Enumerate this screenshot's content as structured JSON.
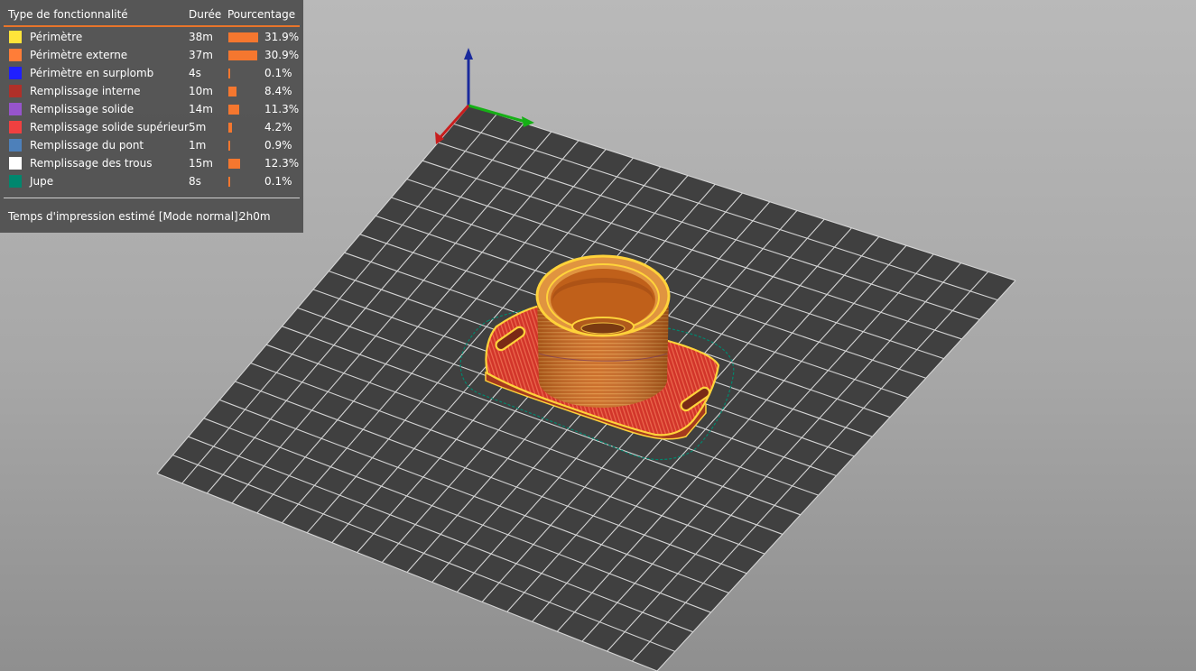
{
  "legend": {
    "headers": {
      "feature": "Type de fonctionnalité",
      "duration": "Durée",
      "percentage": "Pourcentage"
    },
    "items": [
      {
        "label": "Périmètre",
        "duration": "38m",
        "percent": "31.9%",
        "value": 31.9,
        "color": "#ffe43a"
      },
      {
        "label": "Périmètre externe",
        "duration": "37m",
        "percent": "30.9%",
        "value": 30.9,
        "color": "#ff7d38"
      },
      {
        "label": "Périmètre en surplomb",
        "duration": "4s",
        "percent": "0.1%",
        "value": 0.1,
        "color": "#1f1fff"
      },
      {
        "label": "Remplissage interne",
        "duration": "10m",
        "percent": "8.4%",
        "value": 8.4,
        "color": "#b03029"
      },
      {
        "label": "Remplissage solide",
        "duration": "14m",
        "percent": "11.3%",
        "value": 11.3,
        "color": "#9654cc"
      },
      {
        "label": "Remplissage solide supérieur",
        "duration": "5m",
        "percent": "4.2%",
        "value": 4.2,
        "color": "#f04040"
      },
      {
        "label": "Remplissage du pont",
        "duration": "1m",
        "percent": "0.9%",
        "value": 0.9,
        "color": "#4d80ba"
      },
      {
        "label": "Remplissage des trous",
        "duration": "15m",
        "percent": "12.3%",
        "value": 12.3,
        "color": "#ffffff"
      },
      {
        "label": "Jupe",
        "duration": "8s",
        "percent": "0.1%",
        "value": 0.1,
        "color": "#00876e"
      }
    ],
    "bar_max_percent": 31.9,
    "estimated_time_label": "Temps d'impression estimé [Mode normal]:",
    "estimated_time_value": "2h0m"
  },
  "colors": {
    "accent": "#e8742a",
    "bed": "#404040",
    "grid": "#d4d4d4",
    "model_body": "#cc6a1e",
    "model_base": "#d93a2a",
    "perimeter": "#ffd33a",
    "skirt": "#00876e",
    "axis_x": "#c81e1e",
    "axis_y": "#16b016",
    "axis_z": "#1a2a9c"
  }
}
